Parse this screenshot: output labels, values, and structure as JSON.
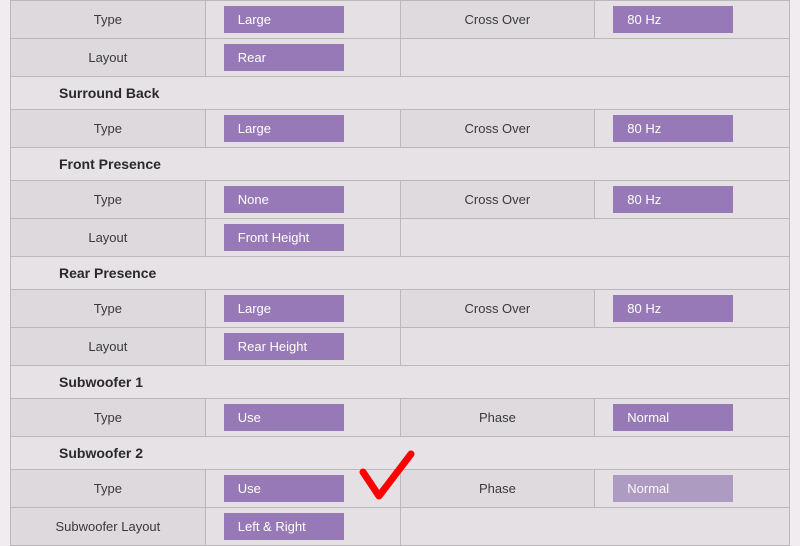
{
  "rows": [
    {
      "kind": "row",
      "c1": "Type",
      "v1": "Large",
      "c2": "Cross Over",
      "v2": "80 Hz"
    },
    {
      "kind": "row",
      "c1": "Layout",
      "v1": "Rear",
      "c2": "",
      "v2": ""
    },
    {
      "kind": "header",
      "title": "Surround Back"
    },
    {
      "kind": "row",
      "c1": "Type",
      "v1": "Large",
      "c2": "Cross Over",
      "v2": "80 Hz"
    },
    {
      "kind": "header",
      "title": "Front Presence"
    },
    {
      "kind": "row",
      "c1": "Type",
      "v1": "None",
      "c2": "Cross Over",
      "v2": "80 Hz"
    },
    {
      "kind": "row",
      "c1": "Layout",
      "v1": "Front Height",
      "c2": "",
      "v2": ""
    },
    {
      "kind": "header",
      "title": "Rear Presence"
    },
    {
      "kind": "row",
      "c1": "Type",
      "v1": "Large",
      "c2": "Cross Over",
      "v2": "80 Hz"
    },
    {
      "kind": "row",
      "c1": "Layout",
      "v1": "Rear Height",
      "c2": "",
      "v2": ""
    },
    {
      "kind": "header",
      "title": "Subwoofer 1"
    },
    {
      "kind": "row",
      "c1": "Type",
      "v1": "Use",
      "c2": "Phase",
      "v2": "Normal"
    },
    {
      "kind": "header",
      "title": "Subwoofer 2"
    },
    {
      "kind": "row",
      "c1": "Type",
      "v1": "Use",
      "c2": "Phase",
      "v2": "Normal",
      "disabled": true
    },
    {
      "kind": "row",
      "c1": "Subwoofer Layout",
      "v1": "Left & Right",
      "c2": "",
      "v2": ""
    }
  ],
  "colors": {
    "accent": "#9779b7"
  }
}
